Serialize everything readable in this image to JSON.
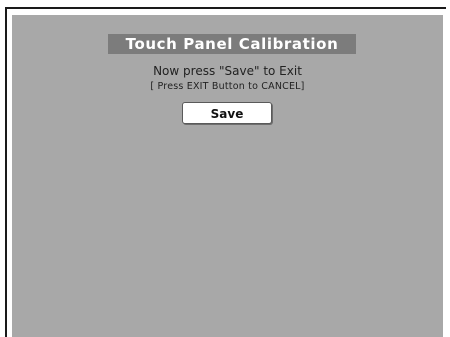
{
  "dialog": {
    "title": "Touch Panel Calibration",
    "instruction": "Now press \"Save\" to Exit",
    "cancel_hint": "[ Press EXIT Button to CANCEL]",
    "save_label": "Save"
  },
  "colors": {
    "screen_background": "#a8a8a8",
    "title_bar_background": "#7c7c7c",
    "title_text": "#ffffff",
    "button_background": "#ffffff"
  }
}
